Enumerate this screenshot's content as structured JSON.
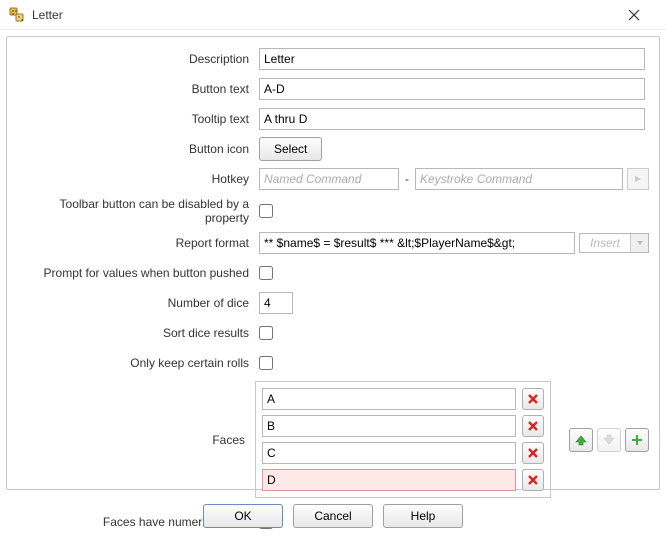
{
  "window": {
    "title": "Letter"
  },
  "labels": {
    "description": "Description",
    "button_text": "Button text",
    "tooltip_text": "Tooltip text",
    "button_icon": "Button icon",
    "hotkey": "Hotkey",
    "toolbar_disable": "Toolbar button can be disabled by a property",
    "report_format": "Report format",
    "prompt_values": "Prompt for values when button pushed",
    "number_dice": "Number of dice",
    "sort_results": "Sort dice results",
    "only_keep": "Only keep certain rolls",
    "faces": "Faces",
    "faces_numeric": "Faces have numeric values"
  },
  "values": {
    "description": "Letter",
    "button_text": "A-D",
    "tooltip_text": "A thru D",
    "hotkey_named_placeholder": "Named Command",
    "hotkey_key_placeholder": "Keystroke Command",
    "report_format": "** $name$ = $result$ *** &lt;$PlayerName$&gt;",
    "insert_label": "Insert",
    "number_dice": "4",
    "select_label": "Select",
    "toolbar_disable_checked": false,
    "prompt_values_checked": false,
    "sort_results_checked": false,
    "only_keep_checked": false,
    "faces_numeric_checked": false
  },
  "faces": [
    {
      "value": "A",
      "selected": false
    },
    {
      "value": "B",
      "selected": false
    },
    {
      "value": "C",
      "selected": false
    },
    {
      "value": "D",
      "selected": true
    }
  ],
  "buttons": {
    "ok": "OK",
    "cancel": "Cancel",
    "help": "Help"
  }
}
